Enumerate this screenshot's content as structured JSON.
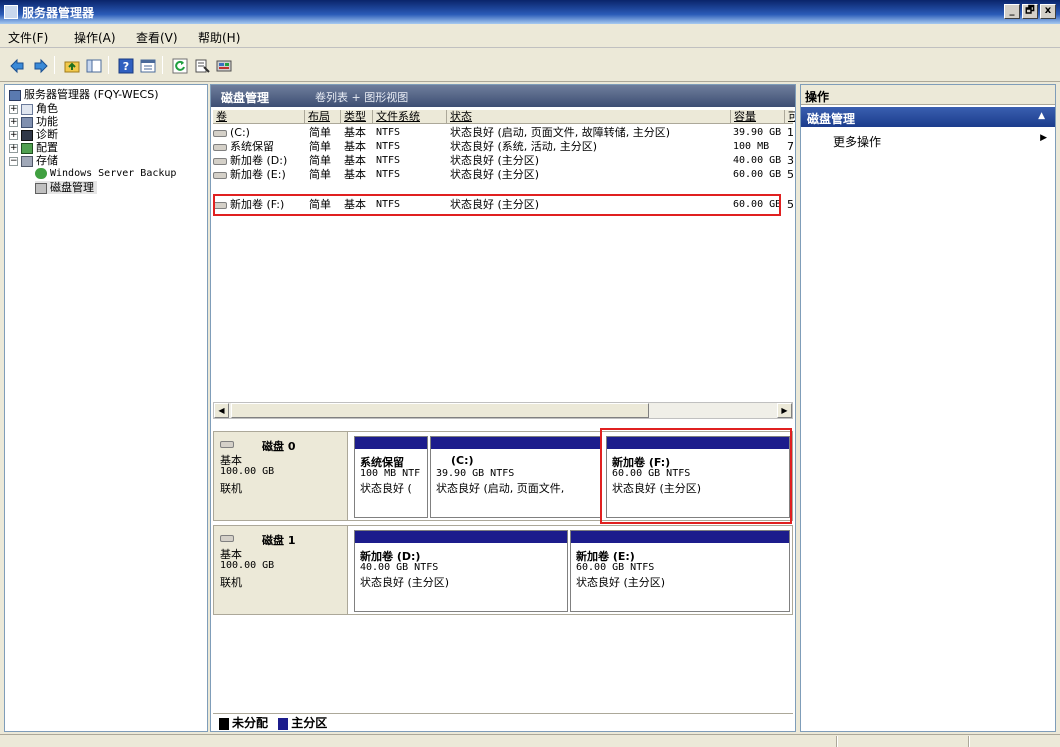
{
  "window": {
    "title": "服务器管理器",
    "buttons": [
      "_",
      "🗗",
      "x"
    ]
  },
  "menu": [
    "文件(F)",
    "操作(A)",
    "查看(V)",
    "帮助(H)"
  ],
  "tree": {
    "root": "服务器管理器 (FQY-WECS)",
    "items": [
      "角色",
      "功能",
      "诊断",
      "配置",
      "存储"
    ],
    "storage_children": [
      "Windows Server Backup",
      "磁盘管理"
    ]
  },
  "main": {
    "title": "磁盘管理",
    "view": "卷列表 + 图形视图",
    "columns": [
      "卷",
      "布局",
      "类型",
      "文件系统",
      "状态",
      "容量",
      "可"
    ],
    "volumes": [
      {
        "name": "(C:)",
        "layout": "简单",
        "type": "基本",
        "fs": "NTFS",
        "status": "状态良好 (启动, 页面文件, 故障转储, 主分区)",
        "capacity": "39.90 GB",
        "free": "1"
      },
      {
        "name": "系统保留",
        "layout": "简单",
        "type": "基本",
        "fs": "NTFS",
        "status": "状态良好 (系统, 活动, 主分区)",
        "capacity": "100 MB",
        "free": "7"
      },
      {
        "name": "新加卷 (D:)",
        "layout": "简单",
        "type": "基本",
        "fs": "NTFS",
        "status": "状态良好 (主分区)",
        "capacity": "40.00 GB",
        "free": "3"
      },
      {
        "name": "新加卷 (E:)",
        "layout": "简单",
        "type": "基本",
        "fs": "NTFS",
        "status": "状态良好 (主分区)",
        "capacity": "60.00 GB",
        "free": "5"
      },
      {
        "name": "新加卷 (F:)",
        "layout": "简单",
        "type": "基本",
        "fs": "NTFS",
        "status": "状态良好 (主分区)",
        "capacity": "60.00 GB",
        "free": "5"
      }
    ],
    "disks": [
      {
        "name": "磁盘 0",
        "type": "基本",
        "size": "100.00 GB",
        "state": "联机",
        "partitions": [
          {
            "name": "系统保留",
            "size": "100 MB NTF",
            "status": "状态良好 ("
          },
          {
            "name": "(C:)",
            "size": "39.90 GB NTFS",
            "status": "状态良好 (启动, 页面文件,"
          },
          {
            "name": "新加卷  (F:)",
            "size": "60.00 GB NTFS",
            "status": "状态良好 (主分区)"
          }
        ]
      },
      {
        "name": "磁盘 1",
        "type": "基本",
        "size": "100.00 GB",
        "state": "联机",
        "partitions": [
          {
            "name": "新加卷  (D:)",
            "size": "40.00 GB NTFS",
            "status": "状态良好 (主分区)"
          },
          {
            "name": "新加卷  (E:)",
            "size": "60.00 GB NTFS",
            "status": "状态良好 (主分区)"
          }
        ]
      }
    ],
    "legend": [
      "未分配",
      "主分区"
    ]
  },
  "actions": {
    "title": "操作",
    "section": "磁盘管理",
    "item": "更多操作"
  },
  "colors": {
    "partition_bar": "#1c1c8c",
    "unallocated": "#000000",
    "highlight": "#e02020"
  }
}
